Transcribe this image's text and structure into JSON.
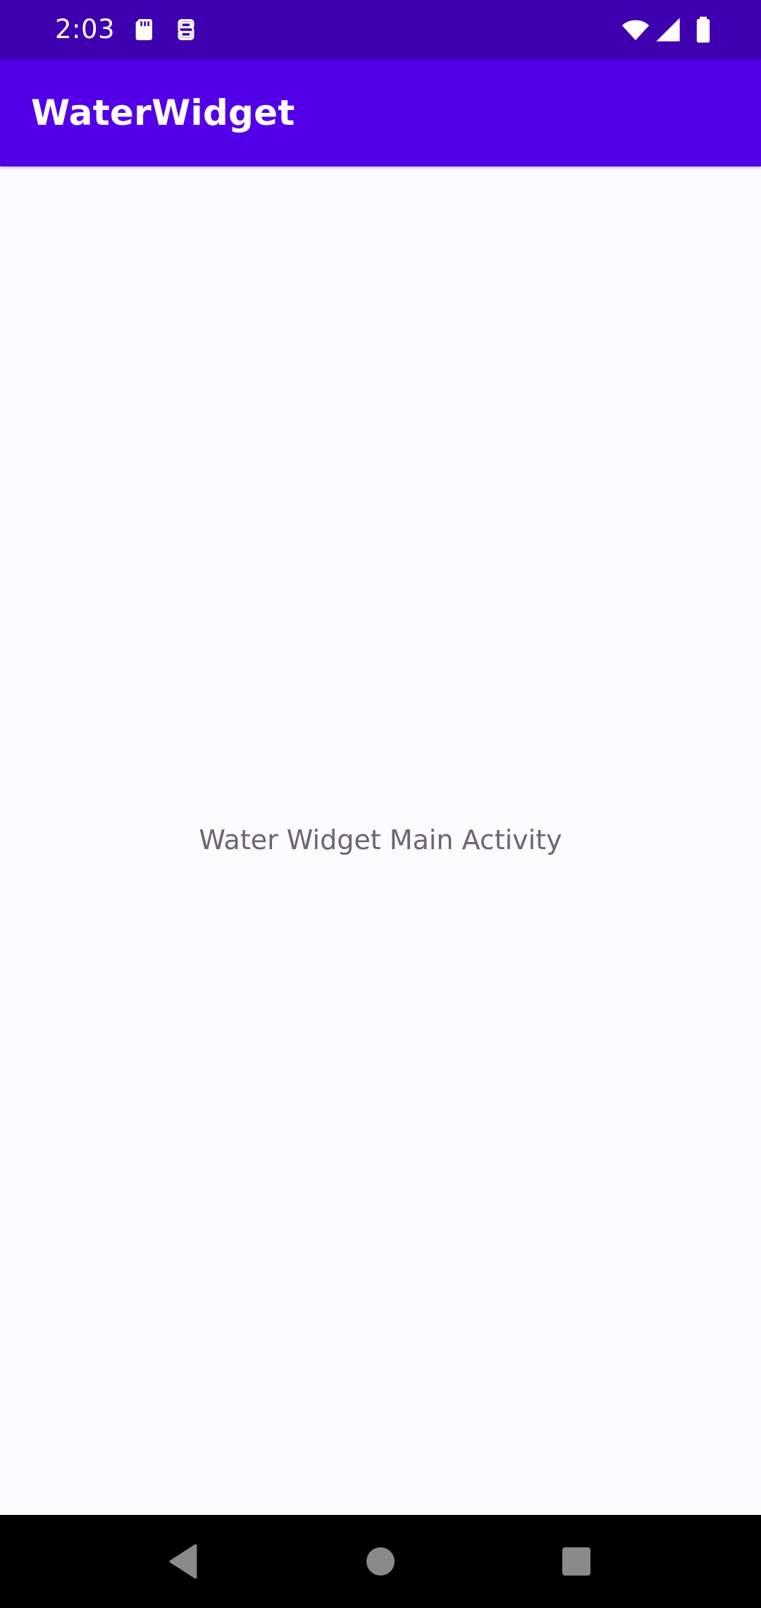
{
  "status_bar": {
    "time": "2:03",
    "left_icons": [
      "sd-card-icon",
      "sync-icon"
    ],
    "right_icons": [
      "wifi-icon",
      "signal-icon",
      "battery-icon"
    ],
    "background": "#3f00b0"
  },
  "app_bar": {
    "title": "WaterWidget",
    "background": "#5300e8"
  },
  "main": {
    "text": "Water Widget Main Activity"
  },
  "nav_bar": {
    "buttons": [
      "back-icon",
      "home-icon",
      "recents-icon"
    ]
  }
}
